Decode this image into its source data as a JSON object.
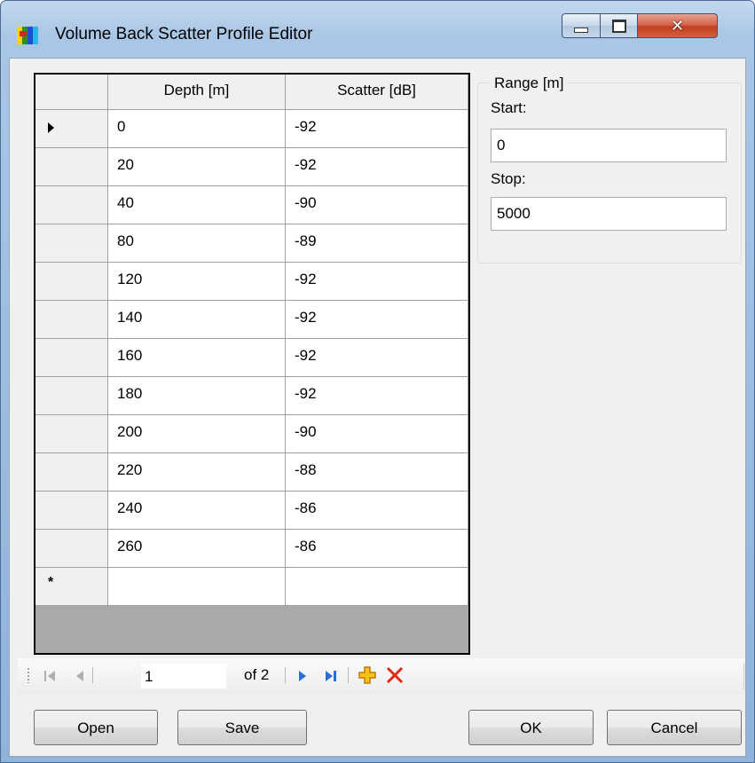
{
  "window": {
    "title": "Volume Back Scatter Profile Editor"
  },
  "grid": {
    "columns": [
      "Depth [m]",
      "Scatter [dB]"
    ],
    "rows": [
      {
        "depth": "0",
        "scatter": "-92"
      },
      {
        "depth": "20",
        "scatter": "-92"
      },
      {
        "depth": "40",
        "scatter": "-90"
      },
      {
        "depth": "80",
        "scatter": "-89"
      },
      {
        "depth": "120",
        "scatter": "-92"
      },
      {
        "depth": "140",
        "scatter": "-92"
      },
      {
        "depth": "160",
        "scatter": "-92"
      },
      {
        "depth": "180",
        "scatter": "-92"
      },
      {
        "depth": "200",
        "scatter": "-90"
      },
      {
        "depth": "220",
        "scatter": "-88"
      },
      {
        "depth": "240",
        "scatter": "-86"
      },
      {
        "depth": "260",
        "scatter": "-86"
      }
    ],
    "new_row_marker": "*"
  },
  "range": {
    "legend": "Range [m]",
    "start_label": "Start:",
    "start_value": "0",
    "stop_label": "Stop:",
    "stop_value": "5000"
  },
  "navigator": {
    "position": "1",
    "of_label": "of 2",
    "icons": [
      "move-first-icon",
      "move-previous-icon",
      "move-next-icon",
      "move-last-icon",
      "add-new-icon",
      "delete-icon"
    ]
  },
  "buttons": {
    "open": "Open",
    "save": "Save",
    "ok": "OK",
    "cancel": "Cancel"
  }
}
